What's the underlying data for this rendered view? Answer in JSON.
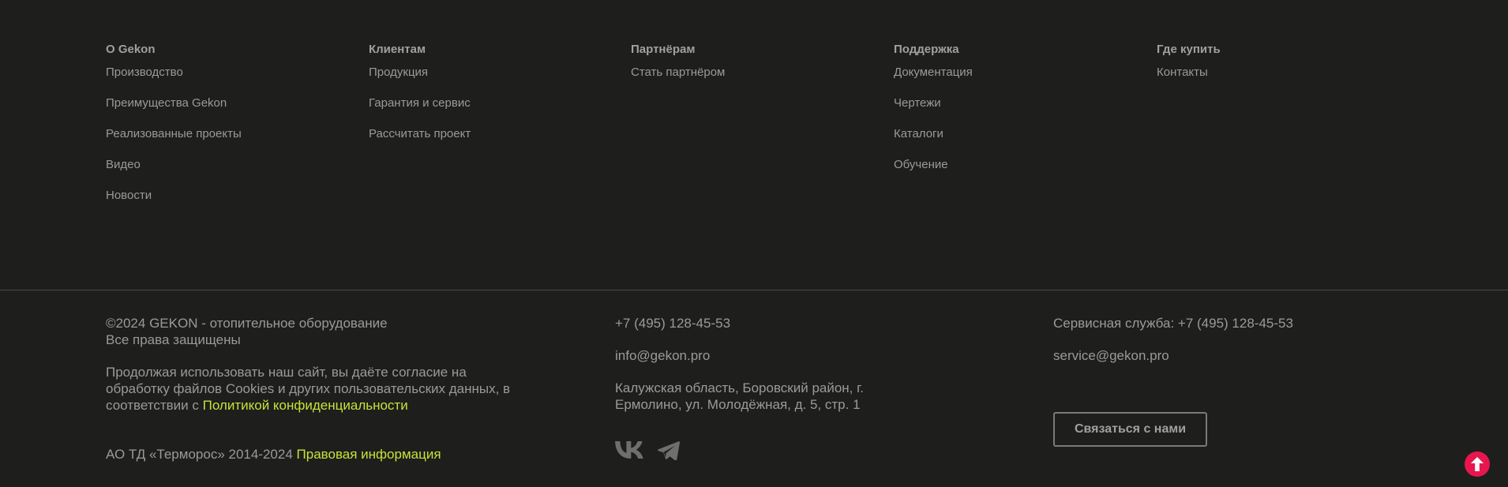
{
  "nav": [
    {
      "title": "О Gekon",
      "items": [
        "Производство",
        "Преимущества Gekon",
        "Реализованные проекты",
        "Видео",
        "Новости"
      ]
    },
    {
      "title": "Клиентам",
      "items": [
        "Продукция",
        "Гарантия и сервис",
        "Рассчитать проект"
      ]
    },
    {
      "title": "Партнёрам",
      "items": [
        "Стать партнёром"
      ]
    },
    {
      "title": "Поддержка",
      "items": [
        "Документация",
        "Чертежи",
        "Каталоги",
        "Обучение"
      ]
    },
    {
      "title": "Где купить",
      "items": [
        "Контакты"
      ]
    }
  ],
  "legal": {
    "copyright_line1": "©2024 GEKON - отопительное оборудование",
    "copyright_line2": "Все права защищены",
    "cookies_text": "Продолжая использовать наш сайт, вы даёте согласие на обработку файлов Cookies и других пользовательских данных, в соответствии с ",
    "privacy_link": "Политикой конфиденциальности",
    "company_text": "АО ТД «Терморос» 2014-2024 ",
    "legal_link": "Правовая информация"
  },
  "contacts": {
    "phone": "+7 (495) 128-45-53",
    "email": "info@gekon.pro",
    "address_line1": "Калужская область, Боровский район, г.",
    "address_line2": "Ермолино, ул. Молодёжная, д. 5, стр. 1"
  },
  "service": {
    "phone_text": "Сервисная служба: +7 (495) 128-45-53",
    "email": "service@gekon.pro",
    "contact_button": "Связаться с нами"
  },
  "icons": {
    "vk": "vk-icon",
    "telegram": "telegram-icon",
    "scroll_top": "arrow-up-icon"
  },
  "colors": {
    "background": "#1e1e1d",
    "accent_link": "#c5e338",
    "scroll_top_bg": "#e8164e"
  }
}
